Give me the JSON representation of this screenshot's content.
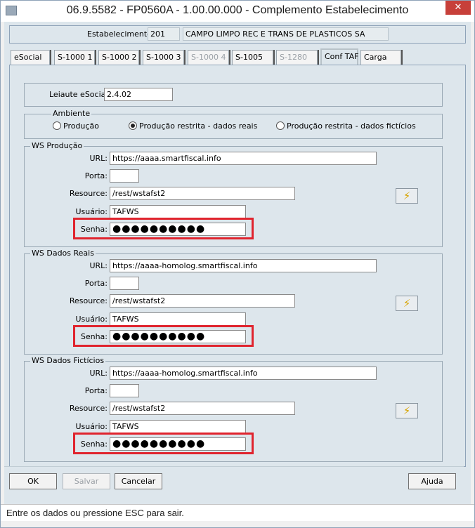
{
  "window": {
    "title": "06.9.5582 - FP0560A - 1.00.00.000 - Complemento Estabelecimento",
    "close_glyph": "✕"
  },
  "estabelecimento": {
    "label": "Estabelecimento:",
    "code": "201",
    "name": "CAMPO LIMPO REC E TRANS DE PLASTICOS SA"
  },
  "tabs": [
    {
      "label": "eSocial",
      "state": "normal"
    },
    {
      "label": "S-1000 1",
      "state": "normal"
    },
    {
      "label": "S-1000 2",
      "state": "normal"
    },
    {
      "label": "S-1000 3",
      "state": "normal"
    },
    {
      "label": "S-1000 4",
      "state": "disabled"
    },
    {
      "label": "S-1005",
      "state": "normal"
    },
    {
      "label": "S-1280",
      "state": "disabled"
    },
    {
      "label": "Conf TAF",
      "state": "active"
    },
    {
      "label": "Carga",
      "state": "normal"
    }
  ],
  "leiaute": {
    "label": "Leiaute eSocial:",
    "value": "2.4.02"
  },
  "ambiente": {
    "title": "Ambiente",
    "options": [
      "Produção",
      "Produção restrita - dados reais",
      "Produção restrita - dados fictícios"
    ],
    "selected": "Produção restrita - dados reais"
  },
  "ws_producao": {
    "title": "WS Produção",
    "url_label": "URL:",
    "url": "https://aaaa.smartfiscal.info",
    "porta_label": "Porta:",
    "porta": "",
    "resource_label": "Resource:",
    "resource": "/rest/wstafst2",
    "usuario_label": "Usuário:",
    "usuario": "TAFWS",
    "senha_label": "Senha:",
    "senha": "●●●●●●●●●●"
  },
  "ws_dados_reais": {
    "title": "WS Dados Reais",
    "url_label": "URL:",
    "url": "https://aaaa-homolog.smartfiscal.info",
    "porta_label": "Porta:",
    "porta": "",
    "resource_label": "Resource:",
    "resource": "/rest/wstafst2",
    "usuario_label": "Usuário:",
    "usuario": "TAFWS",
    "senha_label": "Senha:",
    "senha": "●●●●●●●●●●"
  },
  "ws_dados_ficticios": {
    "title": "WS Dados Fictícios",
    "url_label": "URL:",
    "url": "https://aaaa-homolog.smartfiscal.info",
    "porta_label": "Porta:",
    "porta": "",
    "resource_label": "Resource:",
    "resource": "/rest/wstafst2",
    "usuario_label": "Usuário:",
    "usuario": "TAFWS",
    "senha_label": "Senha:",
    "senha": "●●●●●●●●●●"
  },
  "buttons": {
    "ok": "OK",
    "salvar": "Salvar",
    "cancelar": "Cancelar",
    "ajuda": "Ajuda"
  },
  "test_icon": "lightning-icon",
  "highlight_color": "#e0242e",
  "status": "Entre os dados ou pressione ESC para sair."
}
